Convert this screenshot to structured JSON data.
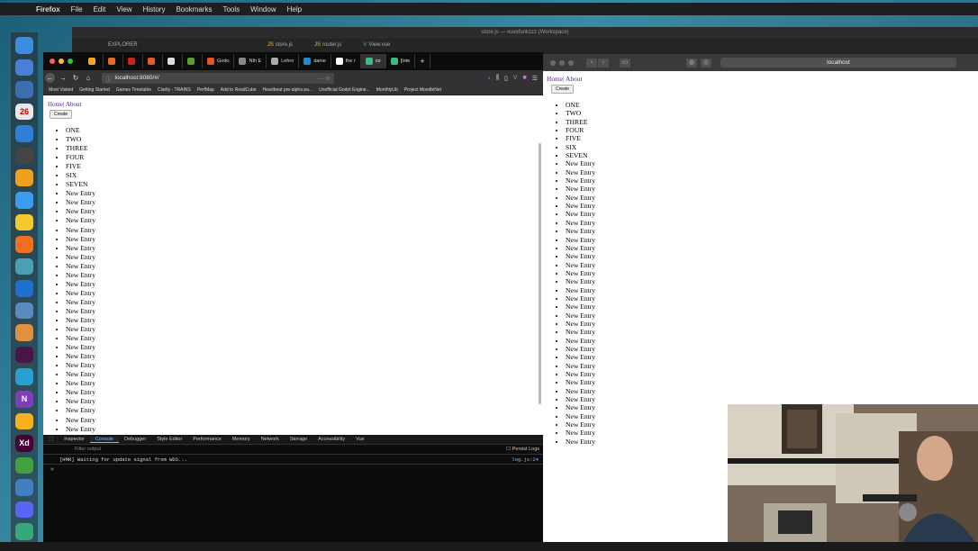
{
  "menubar": {
    "apple": "",
    "items": [
      "Firefox",
      "File",
      "Edit",
      "View",
      "History",
      "Bookmarks",
      "Tools",
      "Window",
      "Help"
    ]
  },
  "dock": {
    "icons": [
      {
        "name": "finder-icon",
        "label": "",
        "color": "#3b8de0"
      },
      {
        "name": "launchpad-icon",
        "label": "",
        "color": "#4a7fd6"
      },
      {
        "name": "info-icon",
        "label": "",
        "color": "#3b6fb0"
      },
      {
        "name": "calendar-icon",
        "label": "26",
        "color": "#e8e8e8"
      },
      {
        "name": "tasks-icon",
        "label": "",
        "color": "#2f7fd8"
      },
      {
        "name": "typora-icon",
        "label": "",
        "color": "#444"
      },
      {
        "name": "star-icon",
        "label": "",
        "color": "#f0a020"
      },
      {
        "name": "messages-icon",
        "label": "",
        "color": "#3a9bf0"
      },
      {
        "name": "butterfly-icon",
        "label": "",
        "color": "#f6c830"
      },
      {
        "name": "firefox-icon",
        "label": "",
        "color": "#f07020"
      },
      {
        "name": "frog-icon",
        "label": "",
        "color": "#49a0b0"
      },
      {
        "name": "outlook-icon",
        "label": "",
        "color": "#1f6fcf"
      },
      {
        "name": "preview-icon",
        "label": "",
        "color": "#5a8ac0"
      },
      {
        "name": "photos-icon",
        "label": "",
        "color": "#e09040"
      },
      {
        "name": "slack-icon",
        "label": "",
        "color": "#4a154b"
      },
      {
        "name": "stats-icon",
        "label": "",
        "color": "#2aa0d0"
      },
      {
        "name": "onenote-icon",
        "label": "N",
        "color": "#7a3fb5"
      },
      {
        "name": "sketch-icon",
        "label": "",
        "color": "#f6b020"
      },
      {
        "name": "xd-icon",
        "label": "Xd",
        "color": "#470137"
      },
      {
        "name": "qt-icon",
        "label": "",
        "color": "#41a040"
      },
      {
        "name": "vpn-icon",
        "label": "",
        "color": "#4080c0"
      },
      {
        "name": "discord-icon",
        "label": "",
        "color": "#5865f2"
      },
      {
        "name": "slack2-icon",
        "label": "",
        "color": "#36a97a"
      }
    ]
  },
  "vscode": {
    "title": "store.js — vuexfunkzzz (Workspace)",
    "tabs": [
      "EXPLORER",
      "store.js",
      "router.js",
      "View.vue"
    ]
  },
  "firefox": {
    "tabs": [
      {
        "label": "",
        "color": "#f6a623"
      },
      {
        "label": "",
        "color": "#e76b23"
      },
      {
        "label": "",
        "color": "#c22"
      },
      {
        "label": "",
        "color": "#e05a2b"
      },
      {
        "label": "",
        "color": "#ddd"
      },
      {
        "label": "",
        "color": "#5c9e31"
      },
      {
        "label": "Godo",
        "color": "#e2532a"
      },
      {
        "label": "Nth E",
        "color": "#888"
      },
      {
        "label": "Lehro",
        "color": "#aaa"
      },
      {
        "label": "danie",
        "color": "#2a88c8"
      },
      {
        "label": "the r",
        "color": "#fff"
      },
      {
        "label": "co",
        "color": "#41b883"
      },
      {
        "label": "[Inte",
        "color": "#41b883"
      }
    ],
    "active_tab_index": 11,
    "url": "localhost:8080/#/",
    "bookmarks": [
      "Most Visited",
      "Getting Started",
      "Games Timetable",
      "Clarity - TRAINS",
      "PerfMap",
      "Add to ReadCube",
      "Heartbeat pre-alpha pa...",
      "Unofficial Godot Engine...",
      "MonthlyLib",
      "Project MoodleNet"
    ]
  },
  "page": {
    "nav_home": "Home",
    "nav_sep": "|",
    "nav_about": "About",
    "create_label": "Create",
    "entries": [
      "ONE",
      "TWO",
      "THREE",
      "FOUR",
      "FIVE",
      "SIX",
      "SEVEN",
      "New Entry",
      "New Entry",
      "New Entry",
      "New Entry",
      "New Entry",
      "New Entry",
      "New Entry",
      "New Entry",
      "New Entry",
      "New Entry",
      "New Entry",
      "New Entry",
      "New Entry",
      "New Entry",
      "New Entry",
      "New Entry",
      "New Entry",
      "New Entry",
      "New Entry",
      "New Entry",
      "New Entry",
      "New Entry",
      "New Entry",
      "New Entry",
      "New Entry",
      "New Entry",
      "New Entry",
      "New Entry",
      "New Entry"
    ]
  },
  "devtools": {
    "tabs": [
      "Inspector",
      "Console",
      "Debugger",
      "Style Editor",
      "Performance",
      "Memory",
      "Network",
      "Storage",
      "Accessibility",
      "Vue"
    ],
    "active_tab": "Console",
    "filter_placeholder": "Filter output",
    "persist_logs": "Persist Logs",
    "message": "[HMR] Waiting for update signal from WDS...",
    "message_source": "log.js:24",
    "prompt": "»"
  },
  "safari": {
    "url": "localhost",
    "entries": [
      "ONE",
      "TWO",
      "THREE",
      "FOUR",
      "FIVE",
      "SIX",
      "SEVEN",
      "New Entry",
      "New Entry",
      "New Entry",
      "New Entry",
      "New Entry",
      "New Entry",
      "New Entry",
      "New Entry",
      "New Entry",
      "New Entry",
      "New Entry",
      "New Entry",
      "New Entry",
      "New Entry",
      "New Entry",
      "New Entry",
      "New Entry",
      "New Entry",
      "New Entry",
      "New Entry",
      "New Entry",
      "New Entry",
      "New Entry",
      "New Entry",
      "New Entry",
      "New Entry",
      "New Entry",
      "New Entry",
      "New Entry",
      "New Entry",
      "New Entry",
      "New Entry",
      "New Entry",
      "New Entry"
    ]
  },
  "colors": {
    "link": "#551a8b",
    "devtools_accent": "#75bfff",
    "traffic_red": "#fe5f57",
    "traffic_yellow": "#febc2e",
    "traffic_green": "#28c840"
  }
}
